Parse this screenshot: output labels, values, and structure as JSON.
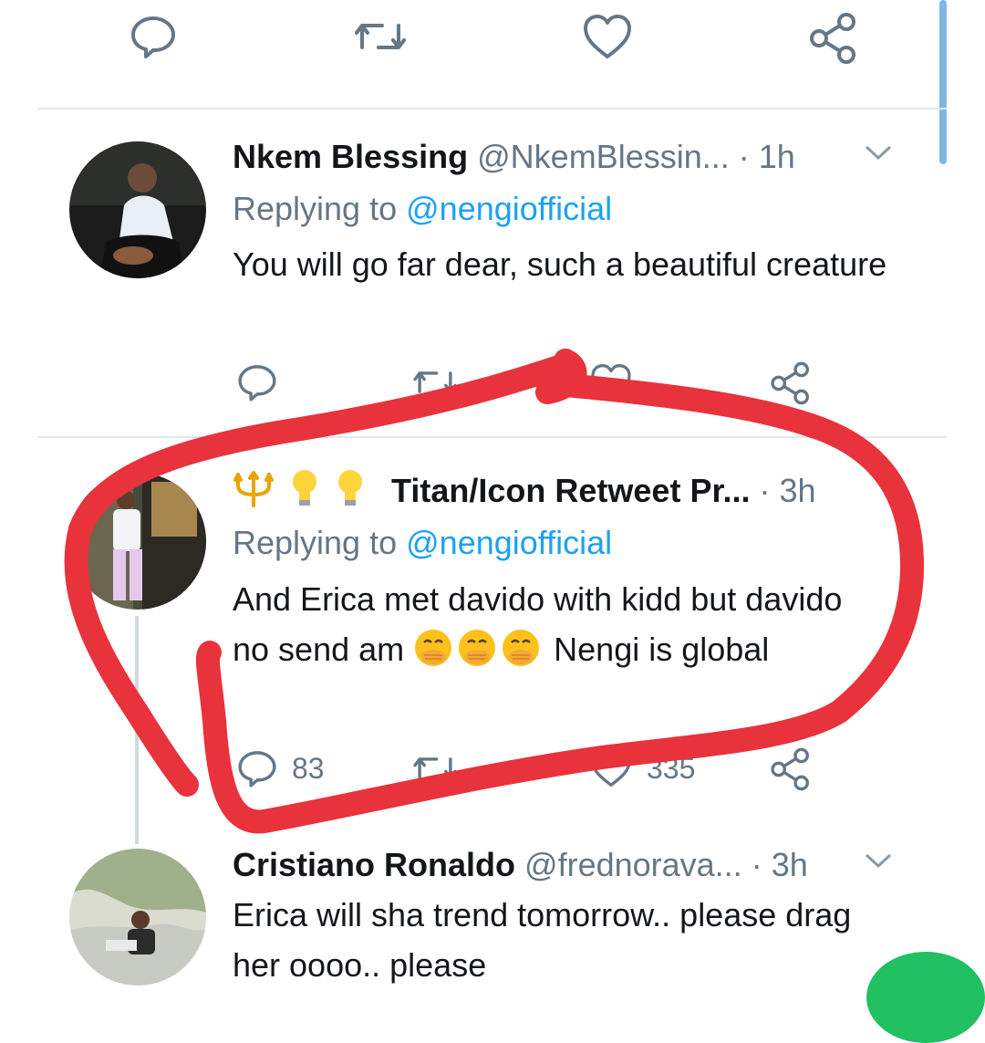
{
  "top_actions": {
    "reply_icon": "speech-bubble-icon",
    "retweet_icon": "retweet-icon",
    "like_icon": "heart-icon",
    "share_icon": "share-icon"
  },
  "tweets": [
    {
      "name": "Nkem Blessing",
      "handle": "@NkemBlessin...",
      "dot": "·",
      "time": "1h",
      "replying_prefix": "Replying to",
      "replying_to": "@nengiofficial",
      "text": "You will go far dear, such a beautiful creature"
    },
    {
      "name_emojis": [
        "trident-icon",
        "lightbulb-icon",
        "lightbulb-icon"
      ],
      "name": "Titan/Icon Retweet Pr...",
      "dot": "·",
      "time": "3h",
      "replying_prefix": "Replying to",
      "replying_to": "@nengiofficial",
      "text_part1": "And Erica met davido with kidd but davido no send am",
      "text_emojis": [
        "face-with-hand-over-mouth-icon",
        "face-with-hand-over-mouth-icon",
        "face-with-hand-over-mouth-icon"
      ],
      "text_part2": "Nengi is global",
      "reply_count": "83",
      "like_count": "335"
    },
    {
      "name": "Cristiano Ronaldo",
      "handle": "@frednorava...",
      "dot": "·",
      "time": "3h",
      "text": "Erica will sha trend tomorrow.. please drag her oooo.. please"
    }
  ],
  "colors": {
    "accent": "#1da1f2",
    "muted": "#657786",
    "annotation": "#e8323c",
    "divider": "#e1e8ed"
  }
}
